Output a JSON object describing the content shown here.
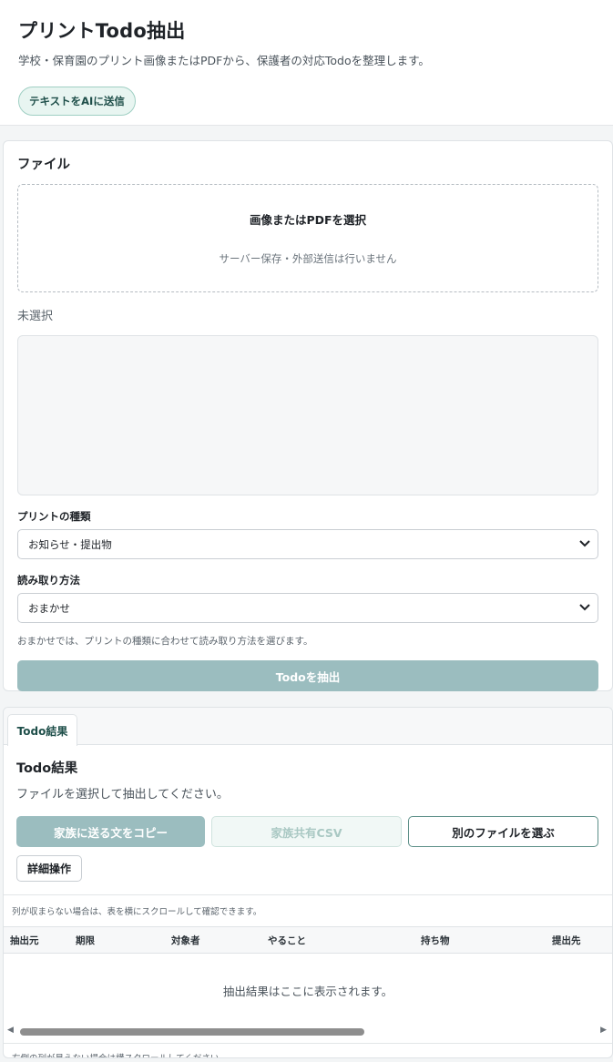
{
  "header": {
    "title": "プリントTodo抽出",
    "subtitle": "学校・保育園のプリント画像またはPDFから、保護者の対応Todoを整理します。",
    "ai_button": "テキストをAIに送信"
  },
  "file_card": {
    "title": "ファイル",
    "dropzone_main": "画像またはPDFを選択",
    "dropzone_sub": "サーバー保存・外部送信は行いません",
    "selected_state": "未選択",
    "print_type_label": "プリントの種類",
    "print_type_value": "お知らせ・提出物",
    "read_method_label": "読み取り方法",
    "read_method_value": "おまかせ",
    "hint": "おまかせでは、プリントの種類に合わせて読み取り方法を選びます。",
    "extract_button": "Todoを抽出"
  },
  "result_card": {
    "tab_label": "Todo結果",
    "title": "Todo結果",
    "description": "ファイルを選択して抽出してください。",
    "copy_button": "家族に送る文をコピー",
    "csv_button": "家族共有CSV",
    "other_file_button": "別のファイルを選ぶ",
    "detail_button": "詳細操作",
    "scroll_note": "列が収まらない場合は、表を横にスクロールして確認できます。",
    "columns": [
      "抽出元",
      "期限",
      "対象者",
      "やること",
      "持ち物",
      "提出先"
    ],
    "empty_text": "抽出結果はここに表示されます。",
    "footer_note": "右側の列が見えない場合は横スクロールしてください。"
  },
  "icons": {
    "chevron": "chevron-down-icon",
    "scroll_left": "arrow-left-icon",
    "scroll_right": "arrow-right-icon"
  },
  "colors": {
    "accent": "#9bbdbf",
    "accent_border": "#5c8f88",
    "pill_bg": "#e8f5f1"
  }
}
